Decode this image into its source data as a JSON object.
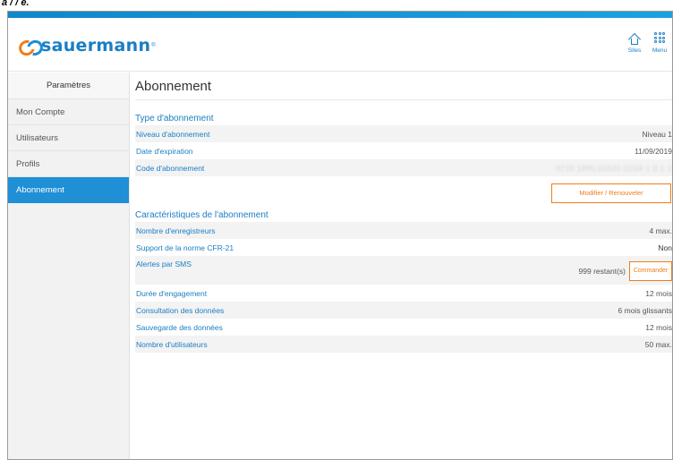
{
  "caption": "a / / e.",
  "brand": {
    "name": "sauermann",
    "reg": "®"
  },
  "header": {
    "sites_label": "Sites",
    "menu_label": "Menu",
    "icons": {
      "sites": "home-icon",
      "menu": "grid-icon"
    }
  },
  "sidebar": {
    "heading": "Paramètres",
    "items": [
      {
        "label": "Mon Compte"
      },
      {
        "label": "Utilisateurs"
      },
      {
        "label": "Profils"
      },
      {
        "label": "Abonnement"
      }
    ],
    "active_index": 3
  },
  "main": {
    "title": "Abonnement",
    "type": {
      "title": "Type d'abonnement",
      "rows": [
        {
          "label": "Niveau d'abonnement",
          "value": "Niveau 1"
        },
        {
          "label": "Date d'expiration",
          "value": "11/09/2019"
        },
        {
          "label": "Code d'abonnement",
          "value": "0710 18RL10630 2C04 1 0 1 2"
        }
      ],
      "modify_label": "Modifier / Renouveler"
    },
    "features": {
      "title": "Caractéristiques de l'abonnement",
      "rows": [
        {
          "label": "Nombre d'enregistreurs",
          "value": "4 max."
        },
        {
          "label": "Support de la norme CFR-21",
          "value": "Non"
        },
        {
          "label": "Alertes par SMS",
          "value": "999 restant(s)",
          "button": "Commander"
        },
        {
          "label": "Durée d'engagement",
          "value": "12 mois"
        },
        {
          "label": "Consultation des données",
          "value": "6 mois glissants"
        },
        {
          "label": "Sauvegarde des données",
          "value": "12 mois"
        },
        {
          "label": "Nombre d'utilisateurs",
          "value": "50 max."
        }
      ]
    }
  },
  "colors": {
    "accent": "#1a7ec4",
    "active": "#1f8fd6",
    "action": "#ef7d1a"
  }
}
